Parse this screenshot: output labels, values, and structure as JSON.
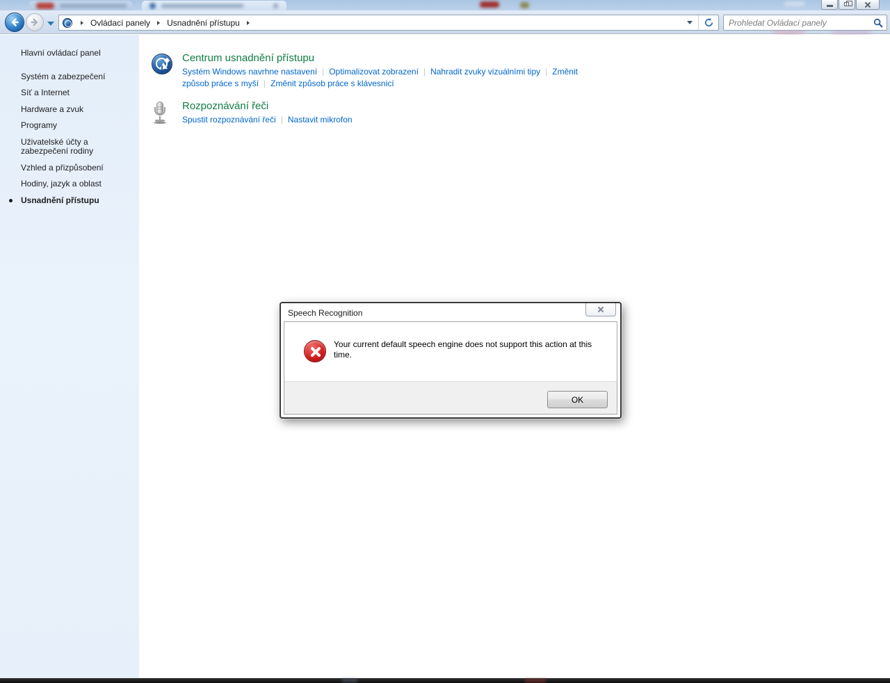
{
  "navbar": {
    "breadcrumb_items": [
      "Ovládací panely",
      "Usnadnění přístupu"
    ],
    "search_placeholder": "Prohledat Ovládací panely"
  },
  "sidebar": {
    "items": [
      {
        "label": "Hlavní ovládací panel",
        "active": false
      },
      {
        "label": "Systém a zabezpečení",
        "active": false
      },
      {
        "label": "Síť a Internet",
        "active": false
      },
      {
        "label": "Hardware a zvuk",
        "active": false
      },
      {
        "label": "Programy",
        "active": false
      },
      {
        "label": "Uživatelské účty a zabezpečení rodiny",
        "active": false
      },
      {
        "label": "Vzhled a přizpůsobení",
        "active": false
      },
      {
        "label": "Hodiny, jazyk a oblast",
        "active": false
      },
      {
        "label": "Usnadnění přístupu",
        "active": true
      }
    ]
  },
  "main": {
    "sections": [
      {
        "title": "Centrum usnadnění přístupu",
        "icon": "ease-of-access-icon",
        "links": [
          "Systém Windows navrhne nastavení",
          "Optimalizovat zobrazení",
          "Nahradit zvuky vizuálními tipy",
          "Změnit způsob práce s myší",
          "Změnit způsob práce s klávesnicí"
        ]
      },
      {
        "title": "Rozpoznávání řeči",
        "icon": "microphone-icon",
        "links": [
          "Spustit rozpoznávání řeči",
          "Nastavit mikrofon"
        ]
      }
    ]
  },
  "dialog": {
    "title": "Speech Recognition",
    "message": "Your current default speech engine does not support this action at this time.",
    "ok_label": "OK",
    "icon": "error-icon"
  },
  "colors": {
    "heading_green": "#117d43",
    "link_blue": "#0066cc",
    "error_red": "#c51313",
    "nav_blue": "#d3e1f0"
  }
}
